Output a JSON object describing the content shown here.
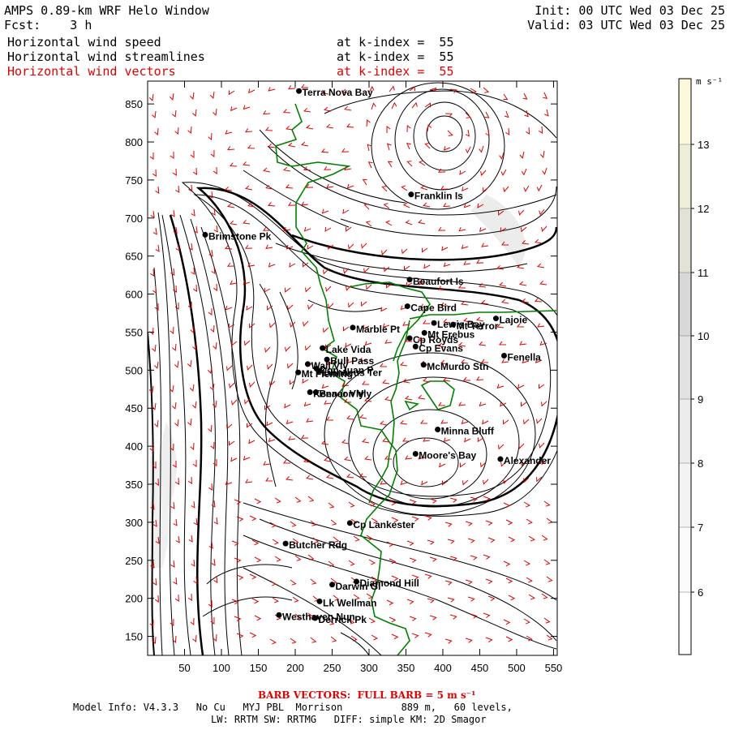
{
  "header": {
    "title": "AMPS 0.89-km WRF Helo Window",
    "fcst": "Fcst:    3 h",
    "init": "Init: 00 UTC Wed 03 Dec 25",
    "valid": "Valid: 03 UTC Wed 03 Dec 25",
    "fields": [
      {
        "name": "Horizontal wind speed",
        "level": "at k-index =  55",
        "color": "#000000"
      },
      {
        "name": "Horizontal wind streamlines",
        "level": "at k-index =  55",
        "color": "#000000"
      },
      {
        "name": "Horizontal wind vectors",
        "level": "at k-index =  55",
        "color": "#e00000"
      }
    ]
  },
  "axes": {
    "x_ticks": [
      "50",
      "100",
      "150",
      "200",
      "250",
      "300",
      "350",
      "400",
      "450",
      "500",
      "550"
    ],
    "y_ticks": [
      "850",
      "800",
      "750",
      "700",
      "650",
      "600",
      "550",
      "500",
      "450",
      "400",
      "350",
      "300",
      "250",
      "200",
      "150"
    ]
  },
  "colorbar": {
    "unit": "m s⁻¹",
    "labels": [
      "13",
      "12",
      "11",
      "10",
      "9",
      "8",
      "7",
      "6"
    ],
    "colors": [
      "#fbf8dc",
      "#eeeed6",
      "#e2e2d6",
      "#d8d8d8",
      "#e2e2e2",
      "#ebebeb",
      "#f3f3f3",
      "#fafafa",
      "#ffffff"
    ]
  },
  "places": [
    {
      "name": "Terra Nova Bay",
      "x": 205,
      "y": 867
    },
    {
      "name": "Franklin Is",
      "x": 357,
      "y": 731
    },
    {
      "name": "Brimstone Pk",
      "x": 78,
      "y": 678
    },
    {
      "name": "Beaufort Is",
      "x": 355,
      "y": 619
    },
    {
      "name": "Cape Bird",
      "x": 352,
      "y": 584
    },
    {
      "name": "Lewis Bay",
      "x": 388,
      "y": 562
    },
    {
      "name": "Mt Terror",
      "x": 414,
      "y": 560
    },
    {
      "name": "Lajoie",
      "x": 472,
      "y": 568
    },
    {
      "name": "Marble Pt",
      "x": 278,
      "y": 556
    },
    {
      "name": "Cp Royds",
      "x": 355,
      "y": 542
    },
    {
      "name": "Mt Erebus",
      "x": 375,
      "y": 549
    },
    {
      "name": "Cp Evans",
      "x": 363,
      "y": 531
    },
    {
      "name": "Fenella",
      "x": 483,
      "y": 519
    },
    {
      "name": "Lake Vida",
      "x": 237,
      "y": 529
    },
    {
      "name": "Wall Vly",
      "x": 217,
      "y": 508
    },
    {
      "name": "Bull Pass",
      "x": 243,
      "y": 514
    },
    {
      "name": "McMurdo Stn",
      "x": 374,
      "y": 507
    },
    {
      "name": "Don Juan P",
      "x": 229,
      "y": 502
    },
    {
      "name": "Mt Fleming",
      "x": 204,
      "y": 497
    },
    {
      "name": "Linnaeus Ter",
      "x": 232,
      "y": 499
    },
    {
      "name": "Kennar Vly",
      "x": 220,
      "y": 471
    },
    {
      "name": "Beacon Vly",
      "x": 228,
      "y": 471
    },
    {
      "name": "Minna Bluff",
      "x": 393,
      "y": 422
    },
    {
      "name": "Moore's Bay",
      "x": 363,
      "y": 390
    },
    {
      "name": "Alexander",
      "x": 478,
      "y": 383
    },
    {
      "name": "Cp Lankester",
      "x": 274,
      "y": 299
    },
    {
      "name": "Butcher Rdg",
      "x": 187,
      "y": 272
    },
    {
      "name": "Darwin Gl",
      "x": 250,
      "y": 218
    },
    {
      "name": "Diamond Hill",
      "x": 283,
      "y": 222
    },
    {
      "name": "Lk Wellman",
      "x": 233,
      "y": 196
    },
    {
      "name": "Westhaven Nun",
      "x": 178,
      "y": 178
    },
    {
      "name": "Derrick Pk",
      "x": 227,
      "y": 174
    }
  ],
  "footer": {
    "barb_note": "BARB VECTORS:  FULL BARB = 5 m s⁻¹",
    "model_info": "Model Info: V4.3.3   No Cu   MYJ PBL  Morrison          889 m,   60 levels,",
    "model_info2": "LW: RRTM SW: RRTMG   DIFF: simple KM: 2D Smagor"
  }
}
